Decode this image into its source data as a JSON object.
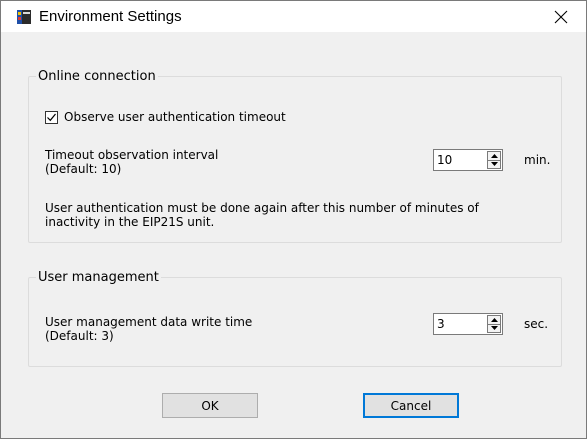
{
  "window": {
    "title": "Environment Settings",
    "app_icon": "settings-app-icon",
    "close_icon": "close-icon"
  },
  "online_connection": {
    "legend": "Online connection",
    "observe_timeout": {
      "label": "Observe user authentication timeout",
      "checked": true
    },
    "interval": {
      "label": "Timeout observation interval",
      "default_text": "(Default: 10)",
      "value": "10",
      "unit": "min."
    },
    "note_line1": "User authentication must be done again after this number of minutes of",
    "note_line2": "inactivity in the EIP21S unit."
  },
  "user_management": {
    "legend": "User management",
    "write_time": {
      "label": "User management data write time",
      "default_text": "(Default: 3)",
      "value": "3",
      "unit": "sec."
    }
  },
  "buttons": {
    "ok": "OK",
    "cancel": "Cancel"
  },
  "colors": {
    "default_button_border": "#0078d7",
    "window_background": "#f0f0f0",
    "titlebar_background": "#ffffff"
  }
}
